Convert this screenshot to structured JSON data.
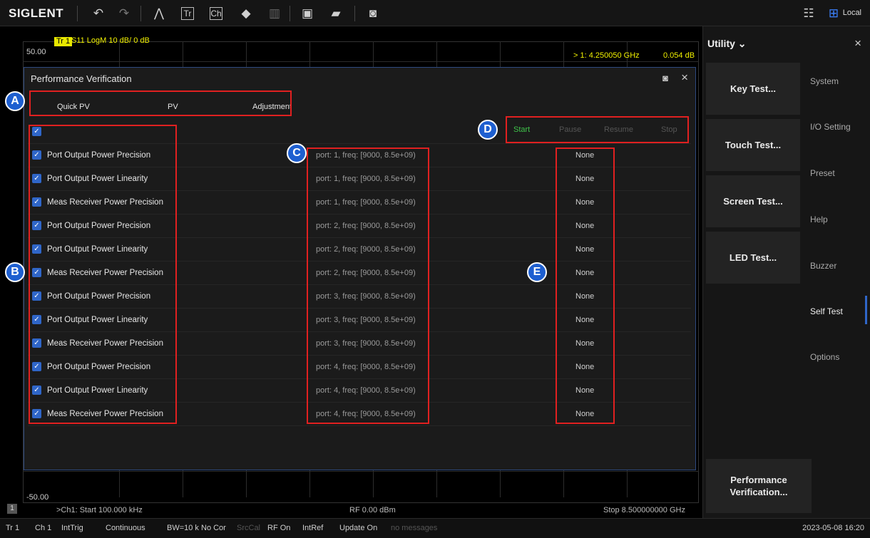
{
  "toolbar": {
    "brand": "SIGLENT",
    "local_label": "Local",
    "icons": [
      "undo-icon",
      "redo-icon",
      "trace-add-icon",
      "trace-add-icon",
      "channel-add-icon",
      "marker-add-icon",
      "delete-icon",
      "save-icon",
      "open-icon",
      "screenshot-icon"
    ]
  },
  "plot": {
    "trace_tag": "Tr 1",
    "trace_info": "S11 LogM 10 dB/ 0 dB",
    "y_top": "50.00",
    "y_bottom": "-50.00",
    "marker_readout": "> 1:  4.250050 GHz",
    "marker_value": "0.054 dB",
    "channel_num": "1",
    "start": ">Ch1: Start 100.000 kHz",
    "rf": "RF 0.00 dBm",
    "stop": "Stop 8.500000000 GHz"
  },
  "dialog": {
    "title": "Performance Verification",
    "tabs": [
      "Quick PV",
      "PV",
      "Adjustment"
    ],
    "controls": {
      "start": "Start",
      "pause": "Pause",
      "resume": "Resume",
      "stop": "Stop"
    },
    "rows": [
      {
        "label": "Port Output Power Precision",
        "param": "port: 1, freq: [9000, 8.5e+09)",
        "result": "None"
      },
      {
        "label": "Port Output Power Linearity",
        "param": "port: 1, freq: [9000, 8.5e+09)",
        "result": "None"
      },
      {
        "label": "Meas Receiver Power Precision",
        "param": "port: 1, freq: [9000, 8.5e+09)",
        "result": "None"
      },
      {
        "label": "Port Output Power Precision",
        "param": "port: 2, freq: [9000, 8.5e+09)",
        "result": "None"
      },
      {
        "label": "Port Output Power Linearity",
        "param": "port: 2, freq: [9000, 8.5e+09)",
        "result": "None"
      },
      {
        "label": "Meas Receiver Power Precision",
        "param": "port: 2, freq: [9000, 8.5e+09)",
        "result": "None"
      },
      {
        "label": "Port Output Power Precision",
        "param": "port: 3, freq: [9000, 8.5e+09)",
        "result": "None"
      },
      {
        "label": "Port Output Power Linearity",
        "param": "port: 3, freq: [9000, 8.5e+09)",
        "result": "None"
      },
      {
        "label": "Meas Receiver Power Precision",
        "param": "port: 3, freq: [9000, 8.5e+09)",
        "result": "None"
      },
      {
        "label": "Port Output Power Precision",
        "param": "port: 4, freq: [9000, 8.5e+09)",
        "result": "None"
      },
      {
        "label": "Port Output Power Linearity",
        "param": "port: 4, freq: [9000, 8.5e+09)",
        "result": "None"
      },
      {
        "label": "Meas Receiver Power Precision",
        "param": "port: 4, freq: [9000, 8.5e+09)",
        "result": "None"
      }
    ]
  },
  "annotations": [
    "A",
    "B",
    "C",
    "D",
    "E"
  ],
  "utility": {
    "title": "Utility ⌄",
    "buttons": [
      "Key Test...",
      "Touch Test...",
      "Screen Test...",
      "LED Test...",
      "Performance Verification..."
    ],
    "side_items": [
      "System",
      "I/O Setting",
      "Preset",
      "Help",
      "Buzzer",
      "Self Test",
      "Options"
    ]
  },
  "status": {
    "items": [
      "Tr 1",
      "Ch 1",
      "IntTrig",
      "Continuous",
      "BW=10 k",
      "No Cor",
      "SrcCal",
      "RF On",
      "IntRef",
      "Update On",
      "no messages"
    ],
    "datetime": "2023-05-08 16:20"
  },
  "colors": {
    "accent": "#2f66c8",
    "start_green": "#3fc24a",
    "trace_yellow": "#f0f000",
    "annotation_red": "#e02020",
    "badge_blue": "#1e5fd0"
  }
}
